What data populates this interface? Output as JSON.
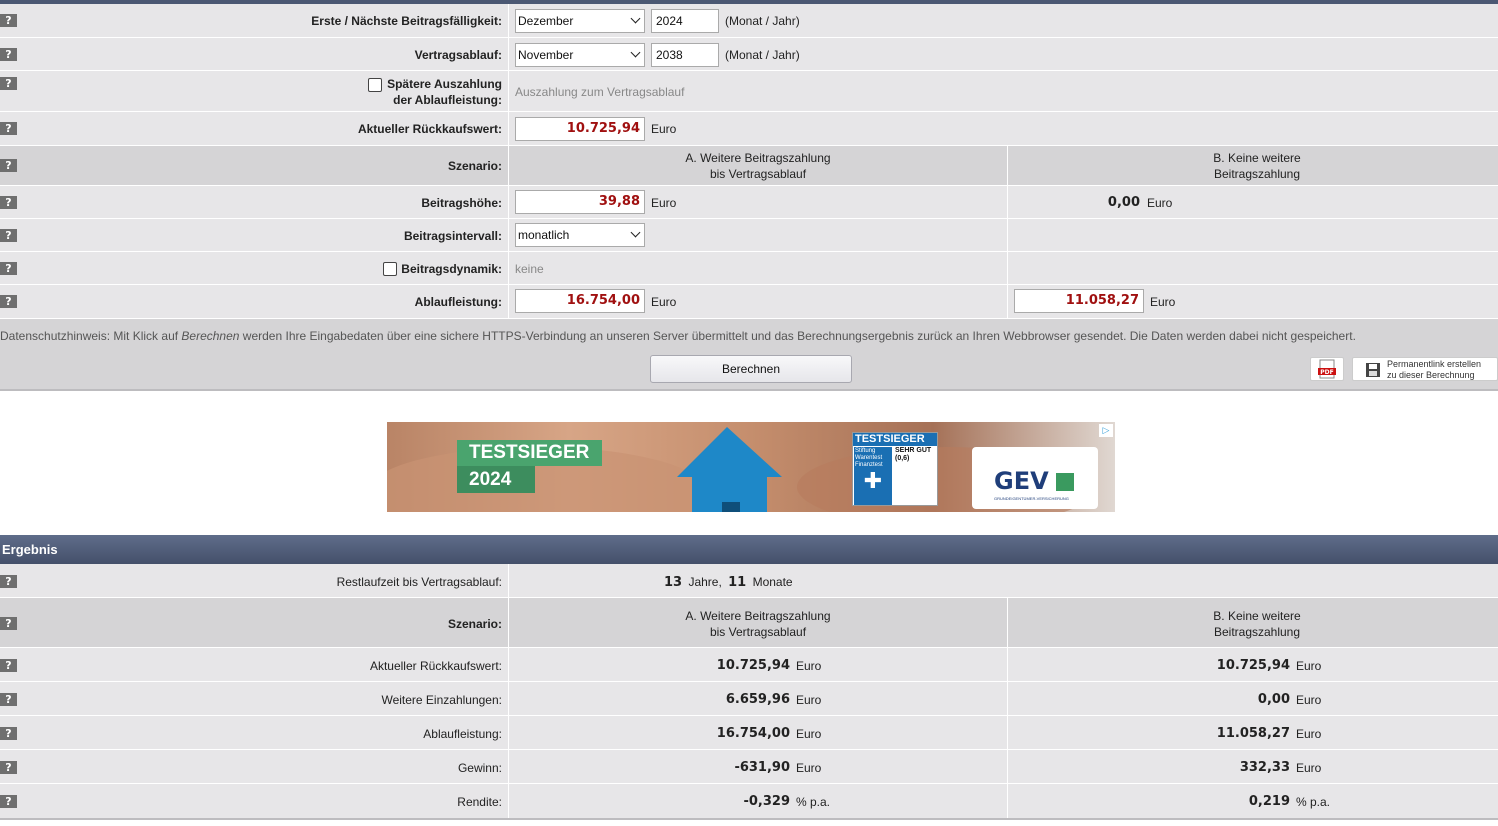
{
  "help_glyph": "?",
  "form": {
    "faelligkeit": {
      "label": "Erste / Nächste Beitragsfälligkeit:",
      "month": "Dezember",
      "year": "2024",
      "unit": "(Monat / Jahr)"
    },
    "vertragsablauf": {
      "label": "Vertragsablauf:",
      "month": "November",
      "year": "2038",
      "unit": "(Monat / Jahr)"
    },
    "spaetere_auszahlung": {
      "label_line1": "Spätere Auszahlung",
      "label_line2": "der Ablaufleistung:",
      "value": "Auszahlung zum Vertragsablauf",
      "checked": false
    },
    "rueckkaufswert": {
      "label": "Aktueller Rückkaufswert:",
      "value": "10.725,94",
      "unit": "Euro"
    },
    "szenario": {
      "label": "Szenario:",
      "a_line1": "A. Weitere Beitragszahlung",
      "a_line2": "bis Vertragsablauf",
      "b_line1": "B. Keine weitere",
      "b_line2": "Beitragszahlung"
    },
    "beitragshoehe": {
      "label": "Beitragshöhe:",
      "a_value": "39,88",
      "b_value": "0,00",
      "unit": "Euro"
    },
    "beitragsintervall": {
      "label": "Beitragsintervall:",
      "value": "monatlich"
    },
    "beitragsdynamik": {
      "label": "Beitragsdynamik:",
      "value": "keine",
      "checked": false
    },
    "ablaufleistung": {
      "label": "Ablaufleistung:",
      "a_value": "16.754,00",
      "b_value": "11.058,27",
      "unit": "Euro"
    }
  },
  "privacy": {
    "before": "Datenschutzhinweis: Mit Klick auf ",
    "em": "Berechnen",
    "after": " werden Ihre Eingabedaten über eine sichere HTTPS-Verbindung an unseren Server übermittelt und das Berechnungsergebnis zurück an Ihren Webbrowser gesendet. Die Daten werden dabei nicht gespeichert."
  },
  "buttons": {
    "calc": "Berechnen",
    "pdf_icon": "PDF",
    "permalink_line1": "Permanentlink erstellen",
    "permalink_line2": "zu dieser Berechnung"
  },
  "ad": {
    "badge_line1": "TESTSIEGER",
    "badge_line2": "2024",
    "seal_title": "TESTSIEGER",
    "seal_org1": "Stiftung",
    "seal_org2": "Warentest",
    "seal_grade": "SEHR GUT",
    "seal_score": "(0,6)",
    "seal_sub": "Finanztest",
    "brand": "GEV",
    "brand_sub": "GRUNDEIGENTÜMER-VERSICHERUNG",
    "ad_choices": "▷"
  },
  "result": {
    "heading": "Ergebnis",
    "restlaufzeit": {
      "label": "Restlaufzeit bis Vertragsablauf:",
      "years": "13",
      "years_unit": "Jahre,",
      "months": "11",
      "months_unit": "Monate"
    },
    "szenario": {
      "label": "Szenario:",
      "a_line1": "A. Weitere Beitragszahlung",
      "a_line2": "bis Vertragsablauf",
      "b_line1": "B. Keine weitere",
      "b_line2": "Beitragszahlung"
    },
    "rows": [
      {
        "label": "Aktueller Rückkaufswert:",
        "a": "10.725,94",
        "b": "10.725,94",
        "unit": "Euro"
      },
      {
        "label": "Weitere Einzahlungen:",
        "a": "6.659,96",
        "b": "0,00",
        "unit": "Euro"
      },
      {
        "label": "Ablaufleistung:",
        "a": "16.754,00",
        "b": "11.058,27",
        "unit": "Euro"
      },
      {
        "label": "Gewinn:",
        "a": "-631,90",
        "b": "332,33",
        "unit": "Euro"
      },
      {
        "label": "Rendite:",
        "a": "-0,329",
        "b": "0,219",
        "unit": "% p.a."
      }
    ]
  }
}
